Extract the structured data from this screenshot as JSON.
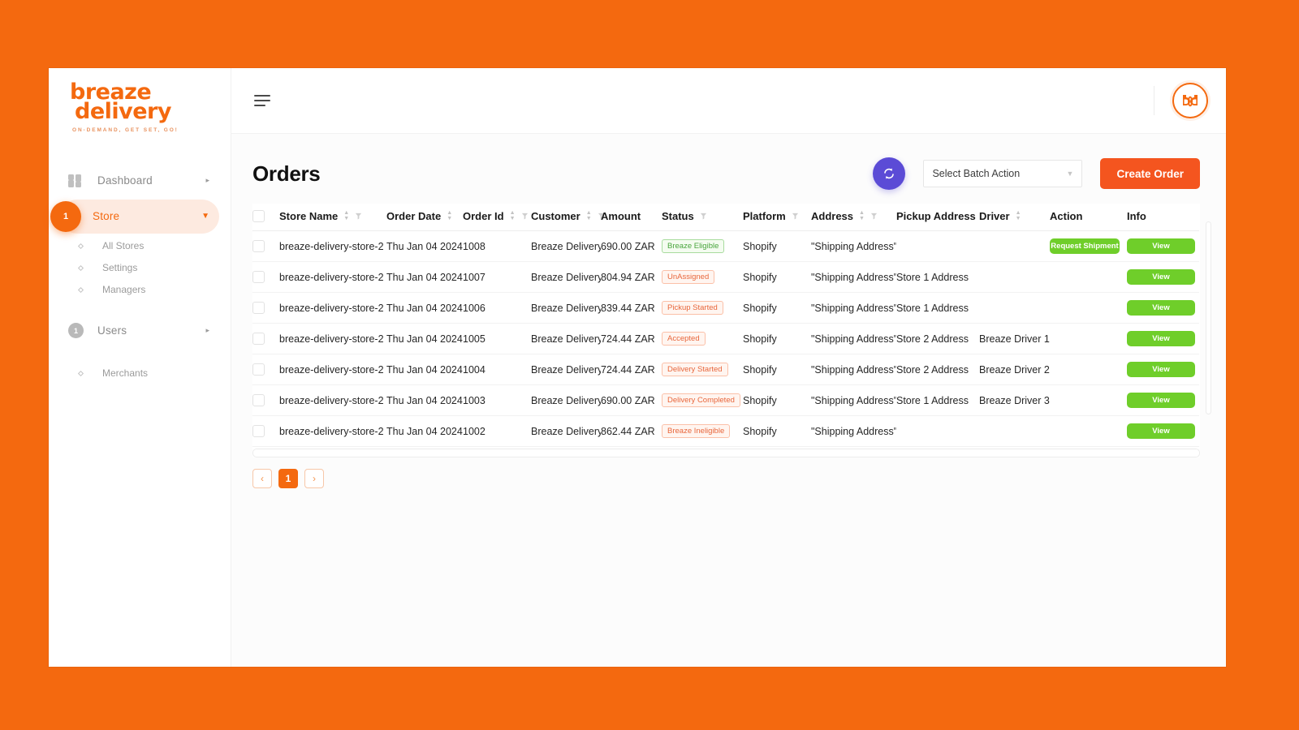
{
  "brand": {
    "logo_line1": "breaze",
    "logo_line2": "delivery",
    "tagline": "ON-DEMAND, GET SET, GO!",
    "accent": "#F4690F",
    "monogram": "bd"
  },
  "sidebar": {
    "items": [
      {
        "label": "Dashboard",
        "icon": "grid-icon",
        "badge": null,
        "active": false,
        "expandable": true
      },
      {
        "label": "Store",
        "icon": "store-badge-icon",
        "badge": "1",
        "active": true,
        "expandable": true
      },
      {
        "label": "Users",
        "icon": "users-badge-icon",
        "badge": "1",
        "active": false,
        "expandable": true
      }
    ],
    "store_children": [
      {
        "label": "All Stores"
      },
      {
        "label": "Settings"
      },
      {
        "label": "Managers"
      }
    ],
    "users_children": [
      {
        "label": "Merchants"
      }
    ]
  },
  "topbar": {
    "menu_icon": "hamburger-icon",
    "brand_mark": "bd"
  },
  "page": {
    "title": "Orders"
  },
  "toolbar": {
    "refresh_icon": "refresh-icon",
    "batch_action_value": "Select Batch Action",
    "batch_action_placeholder": "Select Batch Action",
    "create_order_label": "Create Order",
    "refresh_color": "#5B4BD6",
    "create_color": "#F4551F"
  },
  "table": {
    "columns": [
      {
        "key": "checkbox",
        "label": "",
        "sortable": false,
        "filterable": false
      },
      {
        "key": "store_name",
        "label": "Store Name",
        "sortable": true,
        "filterable": true
      },
      {
        "key": "order_date",
        "label": "Order Date",
        "sortable": true,
        "filterable": false
      },
      {
        "key": "order_id",
        "label": "Order Id",
        "sortable": true,
        "filterable": true
      },
      {
        "key": "customer",
        "label": "Customer",
        "sortable": true,
        "filterable": true
      },
      {
        "key": "amount",
        "label": "Amount",
        "sortable": false,
        "filterable": false
      },
      {
        "key": "status",
        "label": "Status",
        "sortable": false,
        "filterable": true
      },
      {
        "key": "platform",
        "label": "Platform",
        "sortable": false,
        "filterable": true
      },
      {
        "key": "address",
        "label": "Address",
        "sortable": true,
        "filterable": true
      },
      {
        "key": "pickup_address",
        "label": "Pickup Address",
        "sortable": false,
        "filterable": false
      },
      {
        "key": "driver",
        "label": "Driver",
        "sortable": true,
        "filterable": false
      },
      {
        "key": "action",
        "label": "Action",
        "sortable": false,
        "filterable": false
      },
      {
        "key": "info",
        "label": "Info",
        "sortable": false,
        "filterable": false
      }
    ],
    "rows": [
      {
        "store_name": "breaze-delivery-store-2",
        "order_date": "Thu Jan 04 2024",
        "order_id": "1008",
        "customer": "Breaze Delivery",
        "amount": "690.00 ZAR",
        "status": "Breaze Eligible",
        "status_tone": "green",
        "platform": "Shopify",
        "address": "\"Shipping Address\"",
        "pickup_address": "",
        "driver": "",
        "action": "Request Shipment",
        "info": "View"
      },
      {
        "store_name": "breaze-delivery-store-2",
        "order_date": "Thu Jan 04 2024",
        "order_id": "1007",
        "customer": "Breaze Delivery",
        "amount": "804.94 ZAR",
        "status": "UnAssigned",
        "status_tone": "orange",
        "platform": "Shopify",
        "address": "\"Shipping Address\"",
        "pickup_address": "Store 1 Address",
        "driver": "",
        "action": "",
        "info": "View"
      },
      {
        "store_name": "breaze-delivery-store-2",
        "order_date": "Thu Jan 04 2024",
        "order_id": "1006",
        "customer": "Breaze Delivery",
        "amount": "839.44 ZAR",
        "status": "Pickup Started",
        "status_tone": "orange",
        "platform": "Shopify",
        "address": "\"Shipping Address\"",
        "pickup_address": "Store 1 Address",
        "driver": "",
        "action": "",
        "info": "View"
      },
      {
        "store_name": "breaze-delivery-store-2",
        "order_date": "Thu Jan 04 2024",
        "order_id": "1005",
        "customer": "Breaze Delivery",
        "amount": "724.44 ZAR",
        "status": "Accepted",
        "status_tone": "orange",
        "platform": "Shopify",
        "address": "\"Shipping Address\"",
        "pickup_address": "Store 2 Address",
        "driver": "Breaze Driver 1",
        "action": "",
        "info": "View"
      },
      {
        "store_name": "breaze-delivery-store-2",
        "order_date": "Thu Jan 04 2024",
        "order_id": "1004",
        "customer": "Breaze Delivery",
        "amount": "724.44 ZAR",
        "status": "Delivery Started",
        "status_tone": "orange",
        "platform": "Shopify",
        "address": "\"Shipping Address\"",
        "pickup_address": "Store 2 Address",
        "driver": "Breaze Driver 2",
        "action": "",
        "info": "View"
      },
      {
        "store_name": "breaze-delivery-store-2",
        "order_date": "Thu Jan 04 2024",
        "order_id": "1003",
        "customer": "Breaze Delivery",
        "amount": "690.00 ZAR",
        "status": "Delivery Completed",
        "status_tone": "orange",
        "platform": "Shopify",
        "address": "\"Shipping Address\"",
        "pickup_address": "Store 1 Address",
        "driver": "Breaze Driver 3",
        "action": "",
        "info": "View"
      },
      {
        "store_name": "breaze-delivery-store-2",
        "order_date": "Thu Jan 04 2024",
        "order_id": "1002",
        "customer": "Breaze Delivery",
        "amount": "862.44 ZAR",
        "status": "Breaze Ineligible",
        "status_tone": "orange",
        "platform": "Shopify",
        "address": "\"Shipping Address\"",
        "pickup_address": "",
        "driver": "",
        "action": "",
        "info": "View"
      }
    ]
  },
  "pagination": {
    "prev_label": "‹",
    "next_label": "›",
    "pages": [
      "1"
    ],
    "current": "1"
  }
}
